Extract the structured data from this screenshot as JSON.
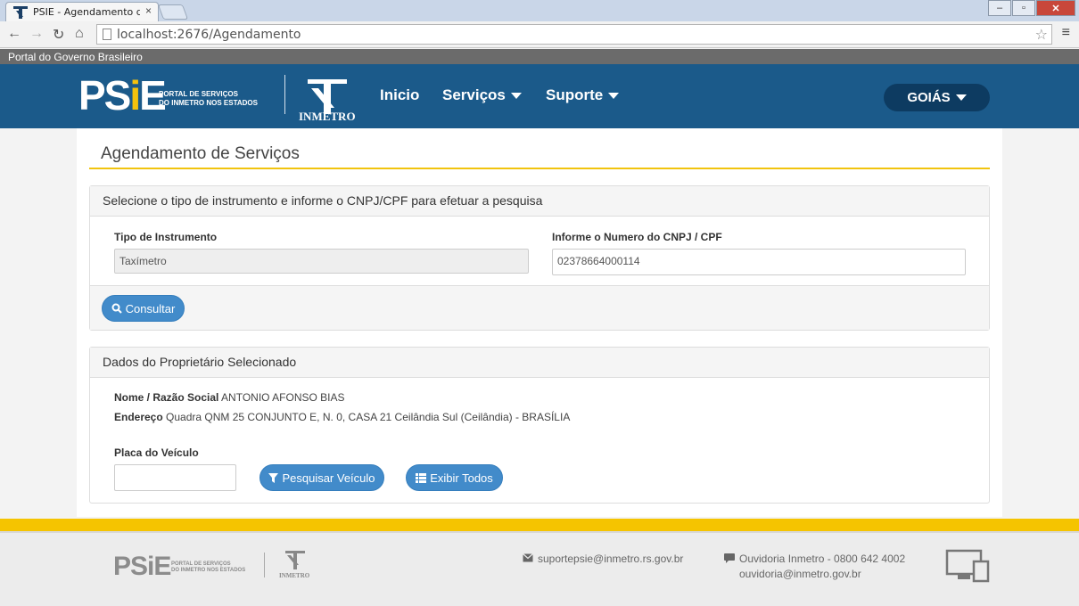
{
  "browser": {
    "tab_title": "PSIE - Agendamento de S",
    "tab_close": "×",
    "url": "localhost:2676/Agendamento",
    "window_buttons": [
      "–",
      "▫",
      "✕"
    ]
  },
  "govbar": {
    "text": "Portal do Governo Brasileiro"
  },
  "header": {
    "logo_text_p": "PS",
    "logo_text_i": "i",
    "logo_text_e": "E",
    "logo_sub_line1": "PORTAL DE SERVIÇOS",
    "logo_sub_line2": "DO INMETRO NOS ESTADOS",
    "inmetro_label": "INMETRO",
    "nav": [
      {
        "label": "Inicio"
      },
      {
        "label": "Serviços"
      },
      {
        "label": "Suporte"
      }
    ],
    "state_button": "GOIÁS"
  },
  "page": {
    "title": "Agendamento de Serviços"
  },
  "search_panel": {
    "heading": "Selecione o tipo de instrumento e informe o CNPJ/CPF para efetuar a pesquisa",
    "instrument_label": "Tipo de Instrumento",
    "instrument_value": "Taxímetro",
    "cnpj_label": "Informe o Numero do CNPJ / CPF",
    "cnpj_value": "02378664000114",
    "consult_button": "Consultar"
  },
  "owner_panel": {
    "heading": "Dados do Proprietário Selecionado",
    "name_label": "Nome / Razão Social",
    "name_value": "ANTONIO AFONSO BIAS",
    "address_label": "Endereço",
    "address_value": "Quadra QNM 25 CONJUNTO E, N. 0, CASA 21 Ceilândia Sul (Ceilândia) - BRASÍLIA",
    "plate_label": "Placa do Veículo",
    "plate_value": "",
    "search_vehicle_button": "Pesquisar Veículo",
    "show_all_button": "Exibir Todos"
  },
  "footer": {
    "logo_text": "PSiE",
    "logo_sub_line1": "PORTAL DE SERVIÇOS",
    "logo_sub_line2": "DO INMETRO NOS ESTADOS",
    "inmetro_label": "INMETRO",
    "support_email": "suportepsie@inmetro.rs.gov.br",
    "ouvidoria_line1": "Ouvidoria Inmetro - 0800 642 4002",
    "ouvidoria_line2": "ouvidoria@inmetro.gov.br"
  },
  "colors": {
    "header_blue": "#1b5a8a",
    "accent_yellow": "#f5c400",
    "button_blue": "#428bca",
    "state_button": "#0d3b61"
  }
}
